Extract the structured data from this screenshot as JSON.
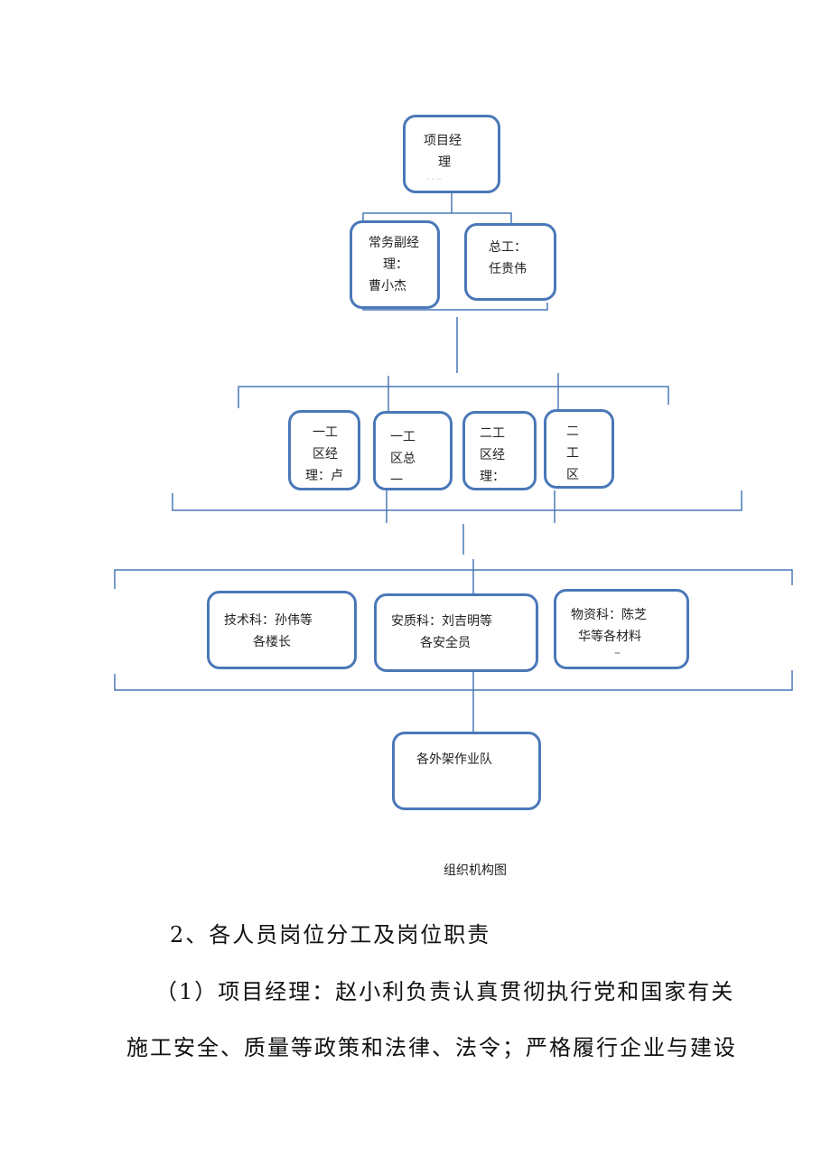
{
  "org_chart": {
    "caption": "组织机构图",
    "line_color": "#4a78b8",
    "nodes": {
      "project_manager": [
        "项目经",
        "理",
        "· · ··"
      ],
      "deputy_manager": [
        "常务副经",
        "理：",
        "曹小杰"
      ],
      "chief_engineer": [
        "总工：",
        "任贵伟"
      ],
      "zone1_manager": [
        "一工",
        "区经",
        "理：卢"
      ],
      "zone1_chief": [
        "一工",
        "区总",
        "一"
      ],
      "zone2_manager": [
        "二工",
        "区经",
        "理："
      ],
      "zone2_other": [
        "二",
        "工",
        "区"
      ],
      "tech_dept": [
        "技术科：孙伟等",
        "各楼长"
      ],
      "safety_dept": [
        "安质科：刘吉明等",
        "各安全员"
      ],
      "material_dept": [
        "物资科：陈芝",
        "华等各材料",
        "–"
      ],
      "scaffold_teams": [
        "各外架作业队"
      ]
    }
  },
  "body": {
    "heading": "2、各人员岗位分工及岗位职责",
    "paragraph_line1": "（1）项目经理：赵小利负责认真贯彻执行党和国家有关",
    "paragraph_line2": "施工安全、质量等政策和法律、法令；严格履行企业与建设"
  }
}
